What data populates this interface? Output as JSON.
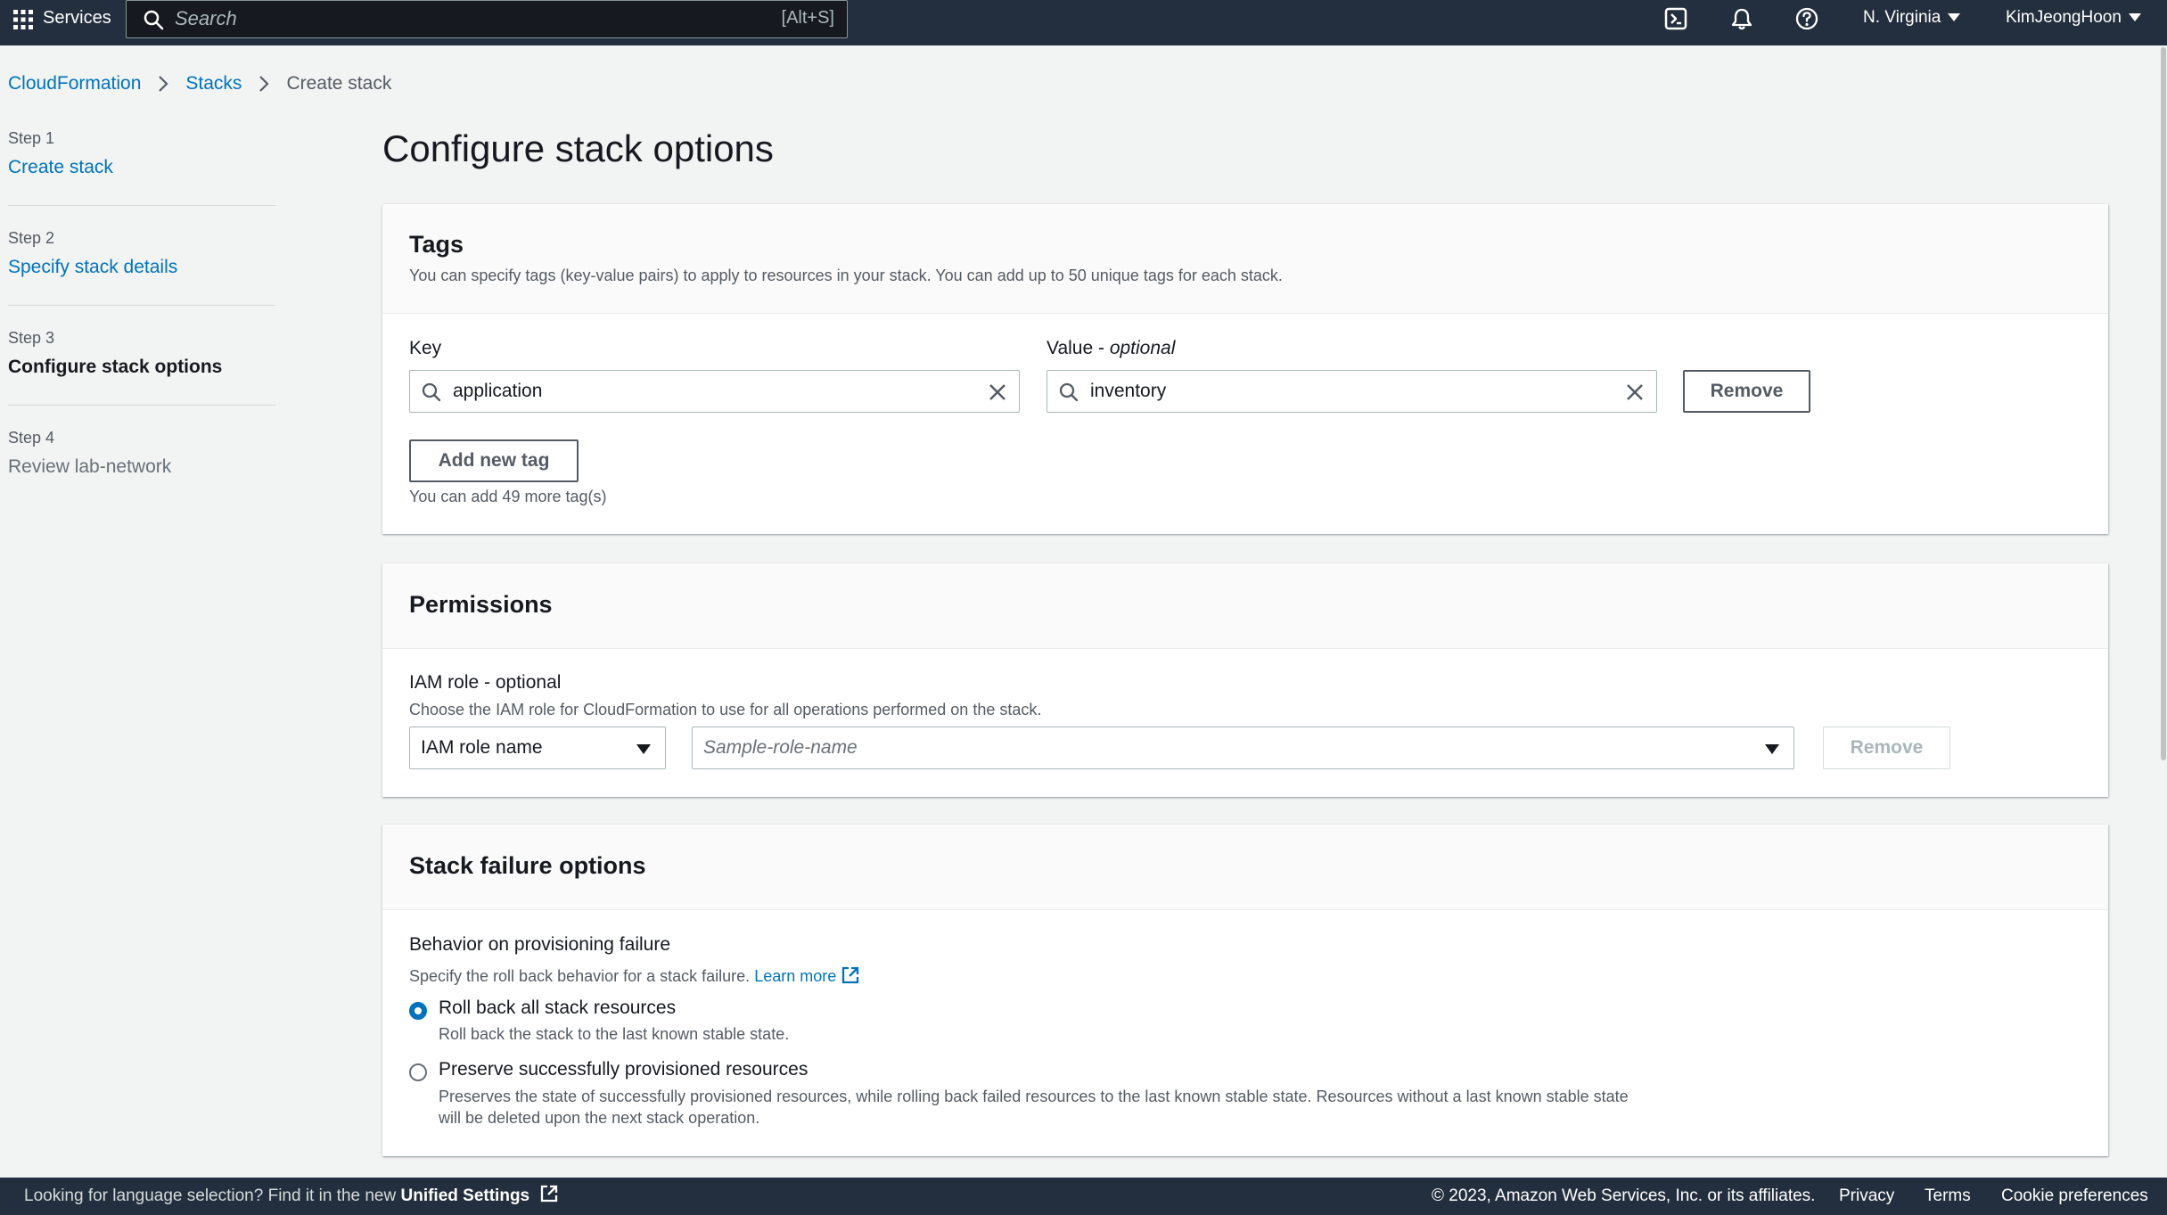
{
  "topnav": {
    "services_label": "Services",
    "search_placeholder": "Search",
    "search_shortcut": "[Alt+S]",
    "region": "N. Virginia",
    "user": "KimJeongHoon",
    "icons": [
      "grid-icon",
      "search-icon",
      "cloudshell-icon",
      "bell-icon",
      "help-icon"
    ]
  },
  "breadcrumb": {
    "items": [
      "CloudFormation",
      "Stacks",
      "Create stack"
    ]
  },
  "steps": [
    {
      "num": "Step 1",
      "title": "Create stack"
    },
    {
      "num": "Step 2",
      "title": "Specify stack details"
    },
    {
      "num": "Step 3",
      "title": "Configure stack options"
    },
    {
      "num": "Step 4",
      "title": "Review lab-network"
    }
  ],
  "page_title": "Configure stack options",
  "tags": {
    "title": "Tags",
    "description": "You can specify tags (key-value pairs) to apply to resources in your stack. You can add up to 50 unique tags for each stack.",
    "key_label": "Key",
    "value_label": "Value - ",
    "value_label_optional": "optional",
    "key_value": "application",
    "value_value": "inventory",
    "remove_label": "Remove",
    "add_label": "Add new tag",
    "remaining": "You can add 49 more tag(s)"
  },
  "permissions": {
    "title": "Permissions",
    "iam_label": "IAM role - optional",
    "iam_description": "Choose the IAM role for CloudFormation to use for all operations performed on the stack.",
    "iam_type_value": "IAM role name",
    "iam_name_placeholder": "Sample-role-name",
    "remove_label": "Remove"
  },
  "failure": {
    "title": "Stack failure options",
    "behavior_label": "Behavior on provisioning failure",
    "behavior_description": "Specify the roll back behavior for a stack failure.",
    "learn_more": "Learn more",
    "options": [
      {
        "label": "Roll back all stack resources",
        "description": "Roll back the stack to the last known stable state.",
        "selected": true
      },
      {
        "label": "Preserve successfully provisioned resources",
        "description_line1": "Preserves the state of successfully provisioned resources, while rolling back failed resources to the last known stable state. Resources without a last known stable state",
        "description_line2": "will be deleted upon the next stack operation.",
        "selected": false
      }
    ]
  },
  "footer": {
    "lang_text": "Looking for language selection? Find it in the new ",
    "unified_settings": "Unified Settings",
    "copyright": "© 2023, Amazon Web Services, Inc. or its affiliates.",
    "privacy": "Privacy",
    "terms": "Terms",
    "cookies": "Cookie preferences"
  },
  "colors": {
    "nav_bg": "#232f3e",
    "link": "#0073bb",
    "page_bg": "#f2f3f3"
  }
}
